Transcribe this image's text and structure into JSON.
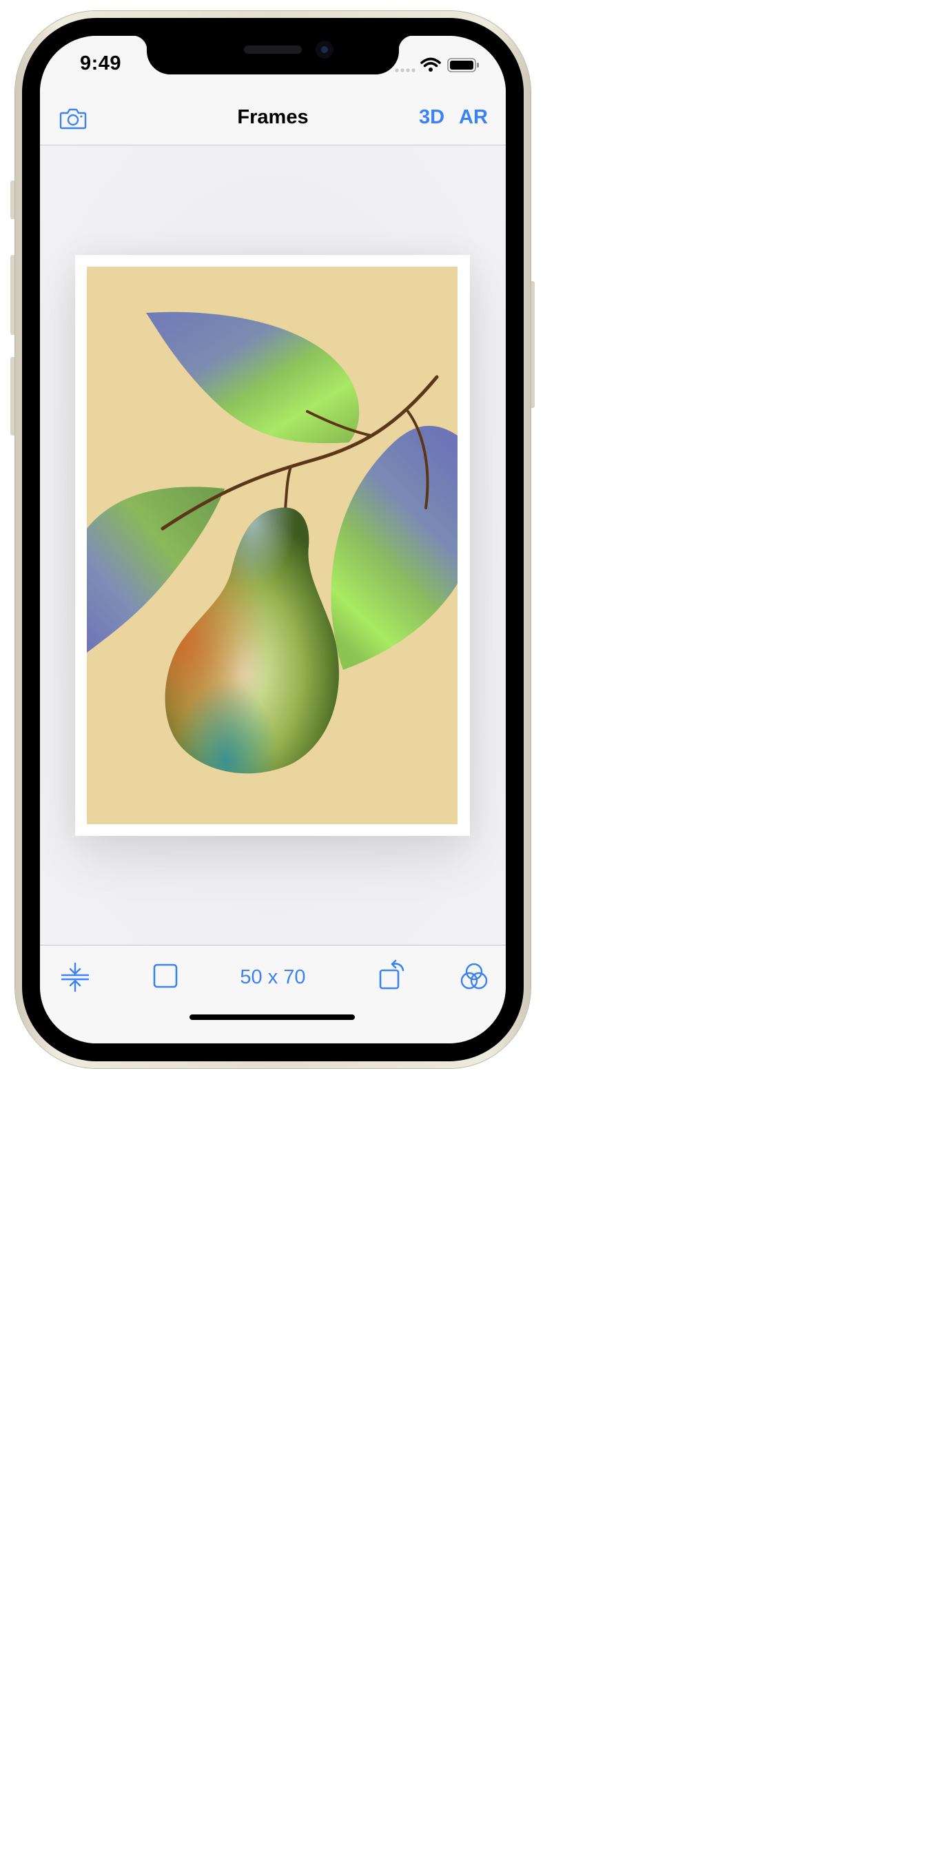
{
  "status_bar": {
    "time": "9:49"
  },
  "nav_bar": {
    "title": "Frames",
    "button_3d": "3D",
    "button_ar": "AR",
    "left_icon": "camera-icon"
  },
  "toolbar": {
    "size_label": "50 x 70",
    "icons": [
      "align-center-icon",
      "square-frame-icon",
      "rotate-icon",
      "color-filter-icon"
    ]
  },
  "colors": {
    "accent": "#3b82f6",
    "artwork_background": "#e9d59d",
    "bar_background": "#f7f7f7"
  }
}
